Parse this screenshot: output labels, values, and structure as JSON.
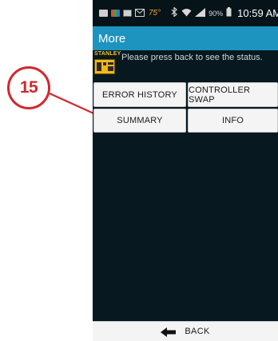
{
  "callout": {
    "number": "15",
    "color": "#d2272e"
  },
  "status_bar": {
    "temperature": "75°",
    "battery_percent": "90%",
    "time": "10:59 AM",
    "icons": [
      "message-icon",
      "app-icon",
      "image-icon",
      "email-icon",
      "bluetooth-icon",
      "wifi-icon",
      "signal-icon",
      "battery-icon"
    ]
  },
  "app_bar": {
    "title": "More",
    "color": "#1d93bf"
  },
  "status": {
    "brand": "STANLEY",
    "message": "Please press back to see the status."
  },
  "buttons": {
    "error_history": "ERROR HISTORY",
    "controller_swap": "CONTROLLER SWAP",
    "summary": "SUMMARY",
    "info": "INFO"
  },
  "back": {
    "label": "BACK"
  }
}
